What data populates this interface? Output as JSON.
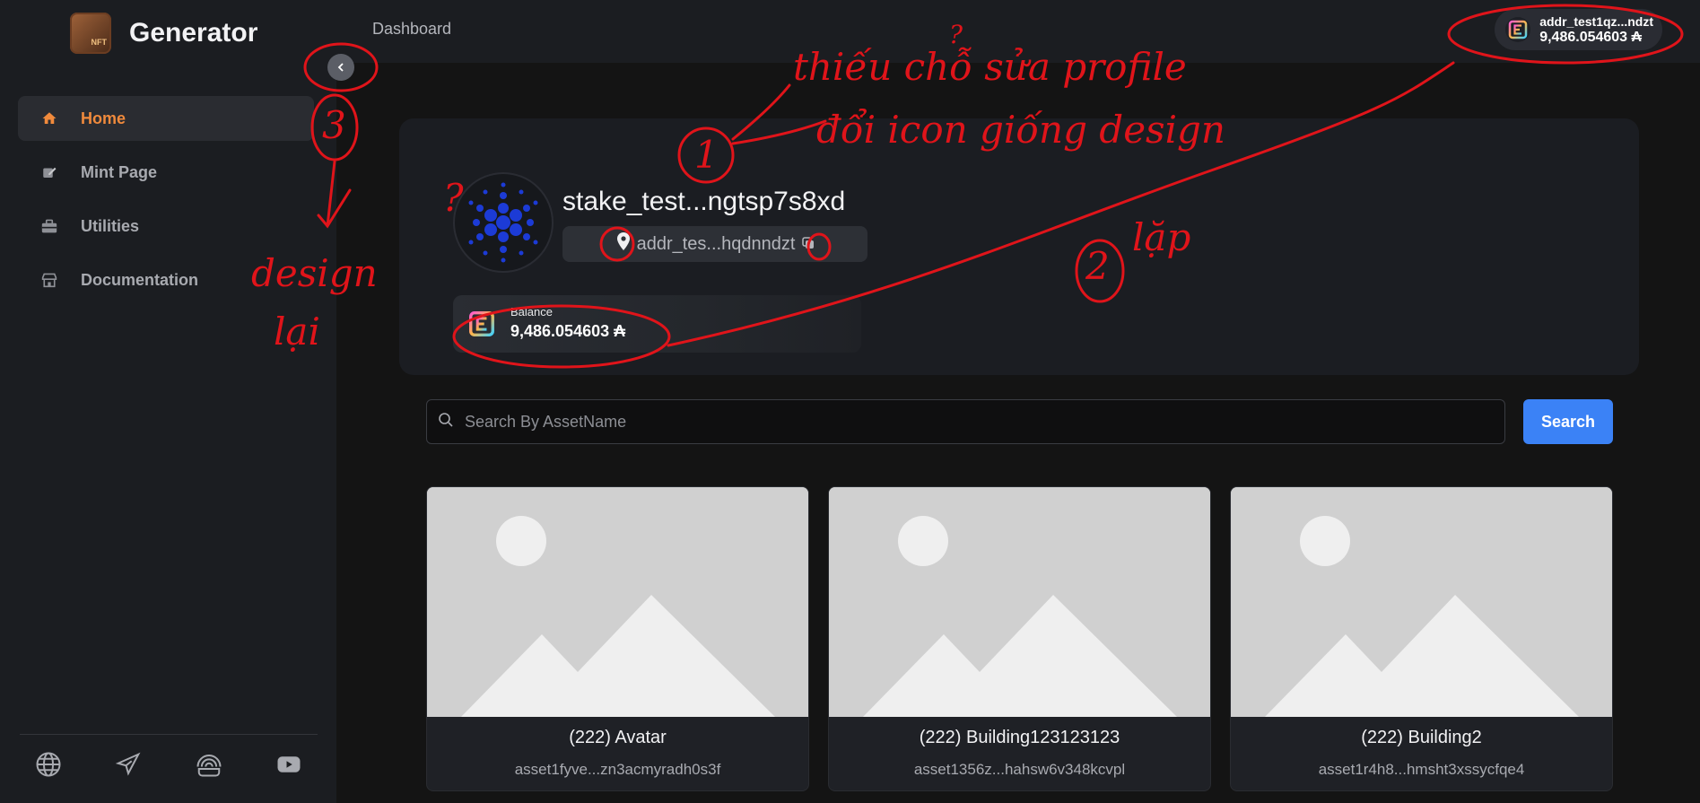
{
  "brand": {
    "title": "Generator",
    "logo_tag": "NFT"
  },
  "sidebar": {
    "items": [
      {
        "label": "Home",
        "icon": "home-icon",
        "active": true
      },
      {
        "label": "Mint Page",
        "icon": "edit-icon"
      },
      {
        "label": "Utilities",
        "icon": "toolbox-icon"
      },
      {
        "label": "Documentation",
        "icon": "store-icon"
      }
    ],
    "social": [
      "globe-icon",
      "telegram-icon",
      "podcast-icon",
      "youtube-icon"
    ]
  },
  "topbar": {
    "breadcrumb": "Dashboard",
    "wallet": {
      "address": "addr_test1qz...ndzt",
      "balance": "9,486.054603 ₳"
    }
  },
  "profile": {
    "stake": "stake_test...ngtsp7s8xd",
    "address": "addr_tes...hqdnndzt",
    "balance_label": "Balance",
    "balance_value": "9,486.054603 ₳"
  },
  "search": {
    "placeholder": "Search By AssetName",
    "value": "",
    "button": "Search"
  },
  "assets": [
    {
      "name": "(222) Avatar",
      "asset_id": "asset1fyve...zn3acmyradh0s3f"
    },
    {
      "name": "(222) Building123123123",
      "asset_id": "asset1356z...hahsw6v348kcvpl"
    },
    {
      "name": "(222) Building2",
      "asset_id": "asset1r4h8...hmsht3xssycfqe4"
    }
  ],
  "annotations": {
    "note1_line1": "thiếu chỗ sửa profile",
    "note1_line2": "đổi icon giống design",
    "num1": "1",
    "num2": "2",
    "note2": "lặp",
    "num3": "3",
    "note3_line1": "design",
    "note3_line2": "lại",
    "q1": "?",
    "q2": "?"
  },
  "colors": {
    "accent": "#f08a3c",
    "primary": "#3b82f6",
    "annotation": "#e0141a"
  }
}
